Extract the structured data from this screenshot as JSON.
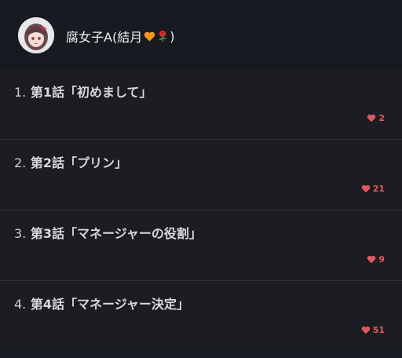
{
  "author": {
    "name": "腐女子A(結月",
    "name_suffix": ")",
    "emoji": [
      "orange-heart",
      "rose"
    ]
  },
  "episodes": [
    {
      "number": "1.",
      "title": "第1話「初めまして」",
      "likes": "2"
    },
    {
      "number": "2.",
      "title": "第2話「プリン」",
      "likes": "21"
    },
    {
      "number": "3.",
      "title": "第3話「マネージャーの役割」",
      "likes": "9"
    },
    {
      "number": "4.",
      "title": "第4話「マネージャー決定」",
      "likes": "51"
    }
  ],
  "colors": {
    "background": "#1c1c23",
    "header": "#171b21",
    "like": "#e2595d",
    "divider": "#31313b"
  }
}
